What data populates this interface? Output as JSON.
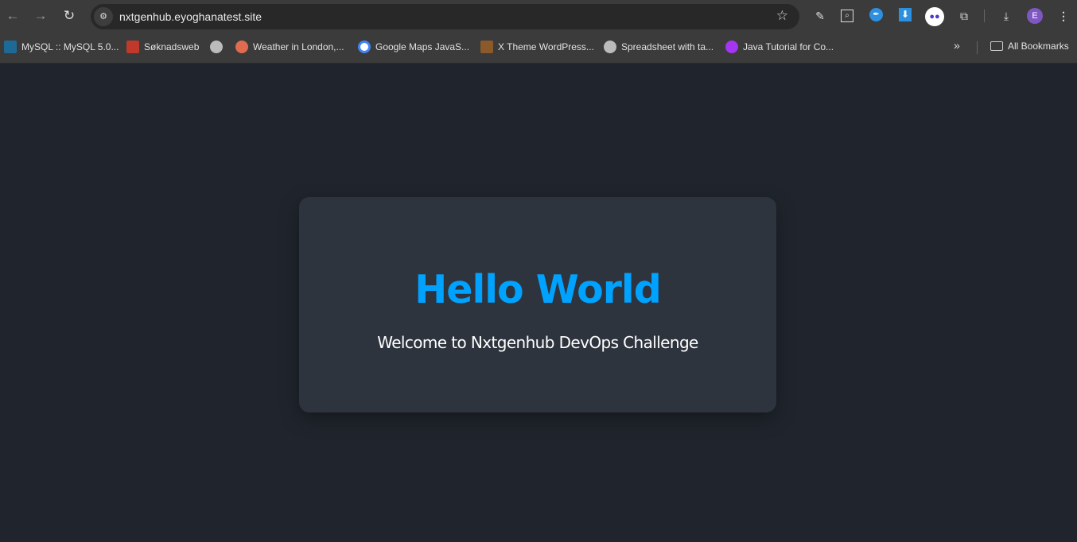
{
  "browser": {
    "url": "nxtgenhub.eyoghanatest.site",
    "nav": {
      "back": "←",
      "forward": "→",
      "reload": "↻"
    },
    "profile_initial": "E",
    "extensions": [
      "eyedropper-icon",
      "search-box-icon",
      "pen-icon",
      "download-arrow-icon",
      "robot-icon",
      "puzzle-icon"
    ],
    "bookmarks": [
      {
        "label": "MySQL :: MySQL 5.0...",
        "icon": "mysql-icon",
        "color": "#1d6a96"
      },
      {
        "label": "Søknadsweb",
        "icon": "soknadsweb-icon",
        "color": "#c0392b"
      },
      {
        "label": "",
        "icon": "globe-icon",
        "color": "#bbbbbb"
      },
      {
        "label": "Weather in London,...",
        "icon": "weather-icon",
        "color": "#e06b4f"
      },
      {
        "label": "Google Maps JavaS...",
        "icon": "google-icon",
        "color": "#ffffff"
      },
      {
        "label": "X Theme WordPress...",
        "icon": "xtheme-icon",
        "color": "#8a5a2b"
      },
      {
        "label": "Spreadsheet with ta...",
        "icon": "globe-icon",
        "color": "#bbbbbb"
      },
      {
        "label": "Java Tutorial for Co...",
        "icon": "udemy-icon",
        "color": "#a435f0"
      }
    ],
    "overflow": "»",
    "all_bookmarks": "All Bookmarks"
  },
  "page": {
    "title": "Hello World",
    "subtitle": "Welcome to Nxtgenhub DevOps Challenge",
    "accent": "#00a2ff",
    "background": "#20252d",
    "card": "#2e343e"
  }
}
